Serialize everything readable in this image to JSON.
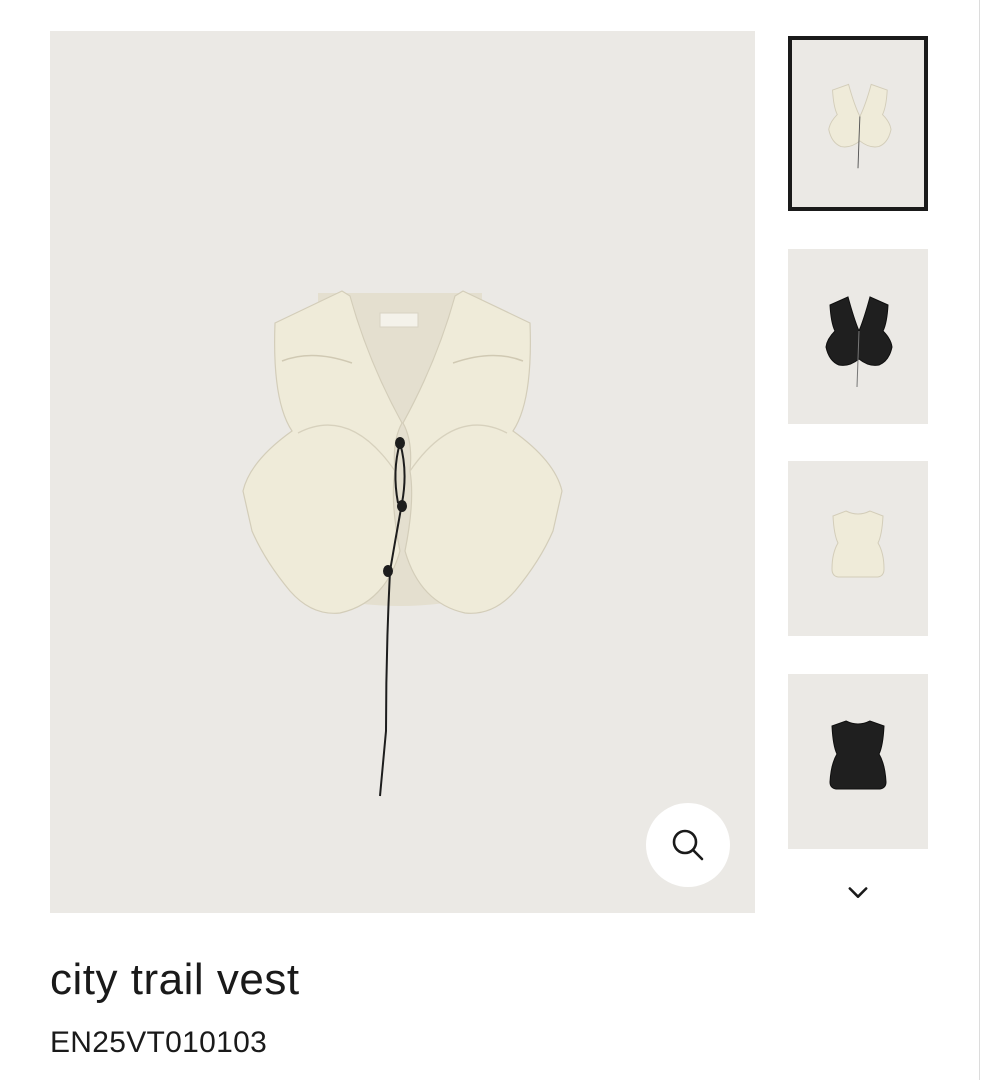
{
  "product": {
    "title": "city trail vest",
    "code": "EN25VT010103"
  },
  "gallery": {
    "main_image": "cream-vest-front-drawstring",
    "zoom_icon": "search-icon",
    "thumbnails": [
      {
        "image": "cream-vest-front",
        "selected": true
      },
      {
        "image": "black-vest-front",
        "selected": false
      },
      {
        "image": "cream-vest-back",
        "selected": false
      },
      {
        "image": "black-vest-back",
        "selected": false
      }
    ],
    "scroll_icon": "chevron-down-icon"
  },
  "colors": {
    "image_background": "#ebe9e5",
    "cream_fabric": "#efebda",
    "black_fabric": "#1f1f1f",
    "selected_border": "#1a1a1a"
  }
}
